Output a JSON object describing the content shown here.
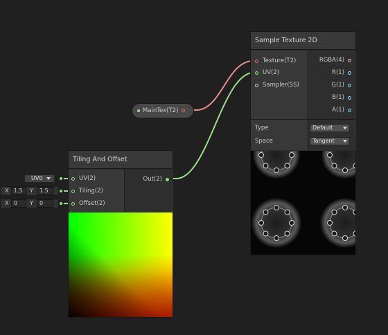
{
  "colors": {
    "canvas": "#202020",
    "vector2_port": "#8fe07a",
    "texture_port": "#e86b6b",
    "sampler_port": "#d0d0d0",
    "rgba_port": "#f4c2c2",
    "float_port": "#84e4ff",
    "wire_texture": "#e98c8c",
    "wire_vector2": "#9ae08c"
  },
  "property_node": {
    "label": "MainTex(T2)",
    "icon": "property-dot-icon"
  },
  "sample_texture": {
    "title": "Sample Texture 2D",
    "inputs": [
      {
        "label": "Texture(T2)",
        "type": "texture"
      },
      {
        "label": "UV(2)",
        "type": "vector2"
      },
      {
        "label": "Sampler(SS)",
        "type": "sampler"
      }
    ],
    "outputs": [
      {
        "label": "RGBA(4)",
        "type": "rgba"
      },
      {
        "label": "R(1)",
        "type": "float"
      },
      {
        "label": "G(1)",
        "type": "float"
      },
      {
        "label": "B(1)",
        "type": "float"
      },
      {
        "label": "A(1)",
        "type": "float"
      }
    ],
    "type_label": "Type",
    "type_value": "Default",
    "space_label": "Space",
    "space_value": "Tangent"
  },
  "tiling_offset": {
    "title": "Tiling And Offset",
    "inputs": [
      {
        "label": "UV(2)"
      },
      {
        "label": "Tiling(2)"
      },
      {
        "label": "Offset(2)"
      }
    ],
    "output": "Out(2)",
    "uv_channel": "UV0",
    "tiling": {
      "x_label": "X",
      "x": "1.5",
      "y_label": "Y",
      "y": "1.5"
    },
    "offset": {
      "x_label": "X",
      "x": "0",
      "y_label": "Y",
      "y": "0"
    }
  }
}
